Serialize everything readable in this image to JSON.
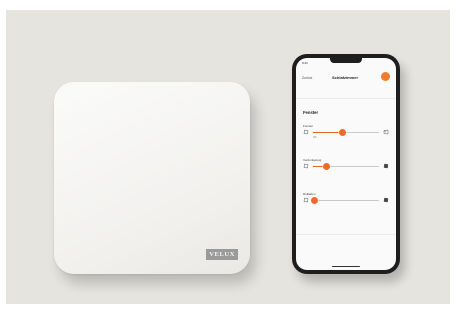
{
  "brand": {
    "logo_text": "VELUX"
  },
  "phone": {
    "status": {
      "time": "9:41",
      "center": "",
      "right": ""
    },
    "nav": {
      "back_label": "Zurück",
      "title": "Schlafzimmer"
    },
    "section_title": "Fenster",
    "rows": [
      {
        "label": "Fenster",
        "sub": "0%",
        "value": 0.45,
        "icon_right": "window-open-icon"
      },
      {
        "label": "Verdunkelung",
        "sub": "",
        "value": 0.2,
        "icon_right": "blind-icon"
      },
      {
        "label": "Rollladen",
        "sub": "",
        "value": 0.02,
        "icon_right": "shutter-icon"
      }
    ]
  },
  "colors": {
    "accent": "#ee6a2c",
    "background": "#e6e4df",
    "phone_frame": "#1e1e1e"
  }
}
